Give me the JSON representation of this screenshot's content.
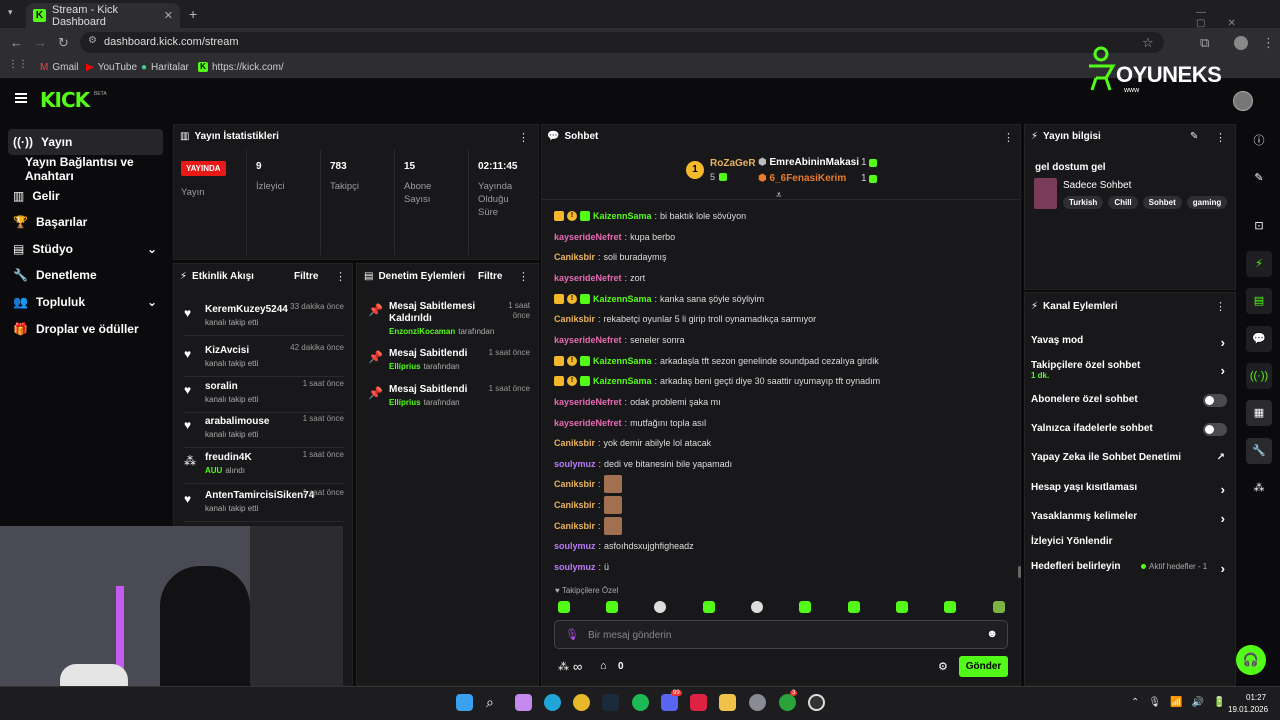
{
  "browser": {
    "tab_title": "Stream - Kick Dashboard",
    "url": "dashboard.kick.com/stream",
    "bookmarks": [
      "Gmail",
      "YouTube",
      "Haritalar",
      "https://kick.com/"
    ]
  },
  "header": {
    "logo": "KICK",
    "beta": "BETA",
    "watermark": "OYUNEKS",
    "watermark_sub": "www"
  },
  "sidebar": {
    "items": [
      {
        "label": "Yayın",
        "active": true
      },
      {
        "label": "Yayın Bağlantısı ve Anahtarı"
      },
      {
        "label": "Gelir"
      },
      {
        "label": "Başarılar"
      },
      {
        "label": "Stüdyo"
      },
      {
        "label": "Denetleme"
      },
      {
        "label": "Topluluk"
      },
      {
        "label": "Droplar ve ödüller"
      }
    ]
  },
  "stats": {
    "title": "Yayın İstatistikleri",
    "badge": "YAYINDA",
    "badge_sub": "Yayın",
    "items": [
      {
        "value": "9",
        "label": "İzleyici"
      },
      {
        "value": "783",
        "label": "Takipçi"
      },
      {
        "value": "15",
        "label": "Abone Sayısı"
      },
      {
        "value": "02:11:45",
        "label": "Yayında Olduğu Süre"
      }
    ]
  },
  "activity": {
    "title": "Etkinlik Akışı",
    "filter": "Filtre",
    "events": [
      {
        "name": "KeremKuzey5244",
        "sub": "kanalı takip etti",
        "time": "33 dakika önce"
      },
      {
        "name": "KizAvcisi",
        "sub": "kanalı takip etti",
        "time": "42 dakika önce"
      },
      {
        "name": "soralin",
        "sub": "kanalı takip etti",
        "time": "1 saat önce"
      },
      {
        "name": "arabalimouse",
        "sub": "kanalı takip etti",
        "time": "1 saat önce"
      },
      {
        "name": "freudin4K",
        "sub_hl": "AUU",
        "sub": "alındı",
        "time": "1 saat önce"
      },
      {
        "name": "AntenTamircisiSiken74",
        "sub": "kanalı takip etti",
        "time": "1 saat önce"
      }
    ]
  },
  "modlog": {
    "title": "Denetim Eylemleri",
    "filter": "Filtre",
    "items": [
      {
        "name": "Mesaj Sabitlemesi Kaldırıldı",
        "by": "EnzonziKocaman",
        "by_suffix": "tarafından",
        "time": "1 saat önce"
      },
      {
        "name": "Mesaj Sabitlendi",
        "by": "Ellíprius",
        "by_suffix": "tarafından",
        "time": "1 saat önce"
      },
      {
        "name": "Mesaj Sabitlendi",
        "by": "Ellíprius",
        "by_suffix": "tarafından",
        "time": "1 saat önce"
      }
    ]
  },
  "chat": {
    "title": "Sohbet",
    "top": {
      "first": "RoZaGeR",
      "first_count": "5",
      "second": "EmreAbininMakasi",
      "second_count": "1",
      "third": "6_6FenasiKerim",
      "third_count": "1"
    },
    "messages": [
      {
        "user": "KaizennSama",
        "cls": "u-g",
        "badges": true,
        "text": "bi baktık lole sövüyon"
      },
      {
        "user": "kayserideNefret",
        "cls": "u-p",
        "text": "kupa berbo"
      },
      {
        "user": "Caniksbir",
        "cls": "u-o",
        "text": "soli buradaymış"
      },
      {
        "user": "kayserideNefret",
        "cls": "u-p",
        "text": "zort"
      },
      {
        "user": "KaizennSama",
        "cls": "u-g",
        "badges": true,
        "text": "kanka sana şöyle söyliyim"
      },
      {
        "user": "Caniksbir",
        "cls": "u-o",
        "text": "rekabetçi oyunlar 5 li girip troll oynamadıkça sarmıyor"
      },
      {
        "user": "kayserideNefret",
        "cls": "u-p",
        "text": "seneler sonra"
      },
      {
        "user": "KaizennSama",
        "cls": "u-g",
        "badges": true,
        "text": "arkadaşla tft sezon genelinde soundpad cezalıya girdik"
      },
      {
        "user": "KaizennSama",
        "cls": "u-g",
        "badges": true,
        "text": "arkadaş beni geçti diye 30 saattir uyumayıp tft oynadım"
      },
      {
        "user": "kayserideNefret",
        "cls": "u-p",
        "text": "odak problemi şaka mı"
      },
      {
        "user": "kayserideNefret",
        "cls": "u-p",
        "text": "mutfağını topla asıl"
      },
      {
        "user": "Caniksbir",
        "cls": "u-o",
        "text": "yok demir abilyle lol atacak"
      },
      {
        "user": "soulymuz",
        "cls": "u-v",
        "text": "dedi ve bitanesini bile yapamadı"
      },
      {
        "user": "Caniksbir",
        "cls": "u-o",
        "emote": true,
        "text": ""
      },
      {
        "user": "Caniksbir",
        "cls": "u-o",
        "emote": true,
        "text": ""
      },
      {
        "user": "Caniksbir",
        "cls": "u-o",
        "emote": true,
        "text": ""
      },
      {
        "user": "soulymuz",
        "cls": "u-v",
        "text": "asfoıhdsxujghfigheadz"
      },
      {
        "user": "soulymuz",
        "cls": "u-v",
        "text": "ü"
      }
    ],
    "followers_only": "Takipçilere Özel",
    "input_placeholder": "Bir mesaj gönderin",
    "infinity": "∞",
    "count": "0",
    "send": "Gönder"
  },
  "info": {
    "title": "Yayın bilgisi",
    "stream_title": "gel dostum gel",
    "category": "Sadece Sohbet",
    "tags": [
      "Turkish",
      "Chill",
      "Sohbet",
      "gaming"
    ]
  },
  "channel": {
    "title": "Kanal Eylemleri",
    "items": [
      {
        "label": "Yavaş mod",
        "kind": "chev"
      },
      {
        "label": "Takipçilere özel sohbet",
        "sub": "1 dk.",
        "kind": "chev"
      },
      {
        "label": "Abonelere özel sohbet",
        "kind": "toggle"
      },
      {
        "label": "Yalnızca ifadelerle sohbet",
        "kind": "toggle"
      },
      {
        "label": "Yapay Zeka ile Sohbet Denetimi",
        "kind": "ext"
      },
      {
        "label": "Hesap yaşı kısıtlaması",
        "kind": "chev"
      },
      {
        "label": "Yasaklanmış kelimeler",
        "kind": "chev"
      },
      {
        "label": "İzleyici Yönlendir",
        "kind": "none"
      },
      {
        "label": "Hedefleri belirleyin",
        "kind": "goal",
        "right": "Aktif hedefler - 1"
      }
    ]
  },
  "taskbar": {
    "time": "01:27",
    "date": "19.01.2026",
    "badge1": "99",
    "badge2": "3"
  }
}
